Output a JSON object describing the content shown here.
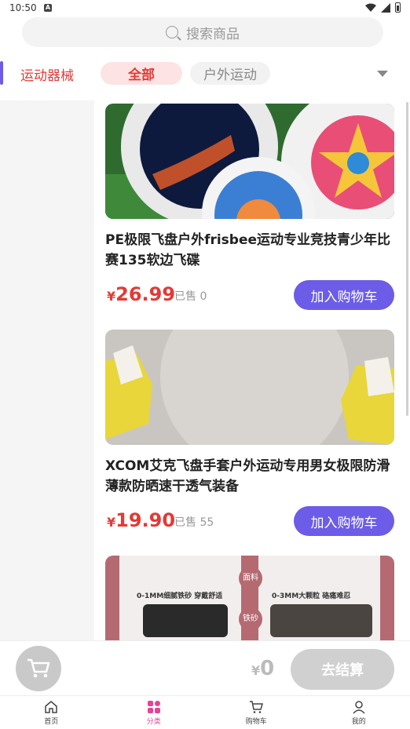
{
  "status_bar": {
    "time": "10:50",
    "notification_letter": "A"
  },
  "search": {
    "placeholder": "搜索商品"
  },
  "category": {
    "current": "运动器械",
    "chips": [
      {
        "label": "全部",
        "active": true
      },
      {
        "label": "户外运动",
        "active": false
      }
    ]
  },
  "products": [
    {
      "title": "PE极限飞盘户外frisbee运动专业竞技青少年比赛135软边飞碟",
      "price_symbol": "¥",
      "price": "26.99",
      "sold": "已售 0",
      "cart_label": "加入购物车"
    },
    {
      "title": "XCOM艾克飞盘手套户外运动专用男女极限防滑薄款防晒速干透气装备",
      "price_symbol": "¥",
      "price": "19.90",
      "sold": "已售 55",
      "cart_label": "加入购物车"
    },
    {
      "image_labels": [
        "面料",
        "铁砂",
        "0-1MM细腻铁砂 穿戴舒适",
        "0-3MM大颗粒 硌痛难忍"
      ]
    }
  ],
  "checkout": {
    "currency": "¥",
    "total": "0",
    "button_label": "去结算"
  },
  "tabbar": {
    "tabs": [
      {
        "label": "首页",
        "icon": "home-icon"
      },
      {
        "label": "分类",
        "icon": "category-icon",
        "active": true
      },
      {
        "label": "购物车",
        "icon": "cart-icon"
      },
      {
        "label": "我的",
        "icon": "user-icon"
      }
    ]
  },
  "colors": {
    "accent": "#6c5ce7",
    "price": "#e53935",
    "tab_active": "#e84393"
  }
}
